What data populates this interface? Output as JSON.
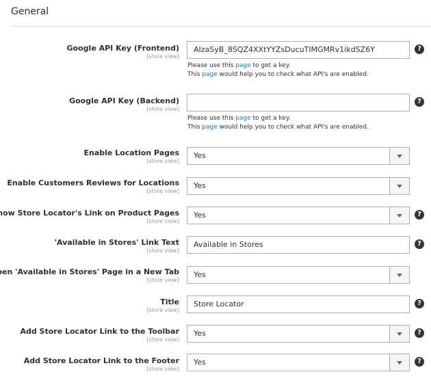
{
  "section": {
    "title": "General"
  },
  "fields": [
    {
      "label": "Google API Key (Frontend)",
      "scope": "[store view]",
      "type": "input",
      "value": "AIzaSyB_8SQZ4XXtYYZsDucuTIMGMRv1ikdSZ6Y",
      "help": true
    },
    {
      "label": "Google API Key (Backend)",
      "scope": "[store view]",
      "type": "input",
      "value": "",
      "help": true
    },
    {
      "label": "Enable Location Pages",
      "scope": "[store view]",
      "type": "select",
      "value": "Yes",
      "help": false
    },
    {
      "label": "Enable Customers Reviews for Locations",
      "scope": "[store view]",
      "type": "select",
      "value": "Yes",
      "help": false
    },
    {
      "label": "Show Store Locator's Link on Product Pages",
      "scope": "[store view]",
      "type": "select",
      "value": "Yes",
      "help": true
    },
    {
      "label": "'Available in Stores' Link Text",
      "scope": "[store view]",
      "type": "input",
      "value": "Available in Stores",
      "help": true
    },
    {
      "label": "Open 'Available in Stores' Page in a New Tab",
      "scope": "[store view]",
      "type": "select",
      "value": "Yes",
      "help": false
    },
    {
      "label": "Title",
      "scope": "[store view]",
      "type": "input",
      "value": "Store Locator",
      "help": true
    },
    {
      "label": "Add Store Locator Link to the Toolbar",
      "scope": "[store view]",
      "type": "select",
      "value": "Yes",
      "help": true
    },
    {
      "label": "Add Store Locator Link to the Footer",
      "scope": "[store view]",
      "type": "select",
      "value": "Yes",
      "help": true
    }
  ],
  "note": {
    "line1_pre": "Please use this ",
    "line1_link": "page",
    "line1_post": " to get a key.",
    "line2_pre": "This ",
    "line2_link": "page",
    "line2_post": " would help you to check what API's are enabled."
  },
  "help_glyph": "?",
  "icons": {
    "help": "question-circle-icon",
    "select": "chevron-down-icon"
  }
}
